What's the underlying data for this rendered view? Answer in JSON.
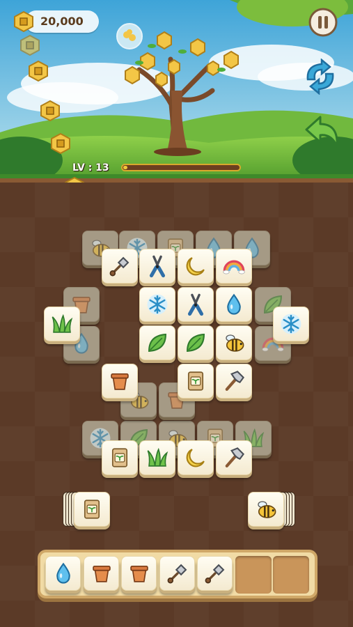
{
  "hud": {
    "coins": "20,000",
    "level_label": "LV : 13",
    "level_progress": 0.02
  },
  "buttons": {
    "pause": "pause-icon",
    "shuffle": "shuffle-icon",
    "undo": "undo-icon"
  },
  "colors": {
    "tray": "#f1dba5",
    "coin": "#f3c646",
    "board": "#5b3a27"
  },
  "board_tiles": [
    {
      "icon": "bee",
      "layer": "under"
    },
    {
      "icon": "snowflake",
      "layer": "under"
    },
    {
      "icon": "seed-bag",
      "layer": "under"
    },
    {
      "icon": "water-drop",
      "layer": "under"
    },
    {
      "icon": "water-drop",
      "layer": "under"
    },
    {
      "icon": "flower-pot",
      "layer": "under"
    },
    {
      "icon": "water-drop",
      "layer": "under"
    },
    {
      "icon": "leaf",
      "layer": "under"
    },
    {
      "icon": "rainbow",
      "layer": "under"
    },
    {
      "icon": "snowflake",
      "layer": "under"
    },
    {
      "icon": "leaf",
      "layer": "under"
    },
    {
      "icon": "bee",
      "layer": "under"
    },
    {
      "icon": "seed-bag",
      "layer": "under"
    },
    {
      "icon": "grass",
      "layer": "under"
    },
    {
      "icon": "bee",
      "layer": "under"
    },
    {
      "icon": "flower-pot",
      "layer": "under"
    },
    {
      "icon": "shovel",
      "layer": "top"
    },
    {
      "icon": "pruning-shears",
      "layer": "top"
    },
    {
      "icon": "moon",
      "layer": "top"
    },
    {
      "icon": "rainbow",
      "layer": "top"
    },
    {
      "icon": "grass",
      "layer": "top"
    },
    {
      "icon": "snowflake",
      "layer": "top"
    },
    {
      "icon": "pruning-shears",
      "layer": "top"
    },
    {
      "icon": "water-drop",
      "layer": "top"
    },
    {
      "icon": "snowflake",
      "layer": "top"
    },
    {
      "icon": "leaf",
      "layer": "top"
    },
    {
      "icon": "leaf",
      "layer": "top"
    },
    {
      "icon": "bee",
      "layer": "top"
    },
    {
      "icon": "flower-pot",
      "layer": "top"
    },
    {
      "icon": "seed-bag",
      "layer": "top"
    },
    {
      "icon": "axe",
      "layer": "top"
    },
    {
      "icon": "seed-bag",
      "layer": "top"
    },
    {
      "icon": "grass",
      "layer": "top"
    },
    {
      "icon": "moon",
      "layer": "top"
    },
    {
      "icon": "axe",
      "layer": "top"
    }
  ],
  "side_stacks": [
    {
      "icon": "seed-bag",
      "side": "left",
      "count": 5
    },
    {
      "icon": "bee",
      "side": "right",
      "count": 5
    }
  ],
  "tray": {
    "capacity": 7,
    "slots": [
      "water-drop",
      "flower-pot",
      "flower-pot",
      "shovel",
      "shovel"
    ]
  }
}
